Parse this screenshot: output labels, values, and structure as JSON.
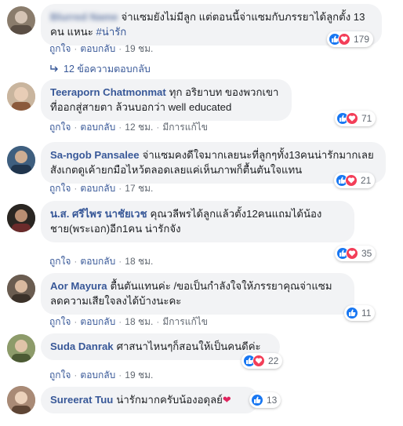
{
  "actions": {
    "like": "ถูกใจ",
    "reply": "ตอบกลับ",
    "edited": "มีการแก้ไข",
    "sep": "·"
  },
  "comments": [
    {
      "author": "Blurred Name",
      "text": "จ่าแซมยังไม่มีลูก แต่ตอนนี้จ่าแซมกับภรรยาได้ลูกตั้ง 13 คน แหนะ ",
      "hashtag": "#น่ารัก",
      "time": "19 ชม.",
      "reactions": "179"
    },
    {
      "author": "Teeraporn Chatmonmat",
      "text": "ทุก อริยาบท ของพวกเขา ที่ออกสู่สายตา ล้วนบอกว่า well educated",
      "time": "12 ชม.",
      "reactions": "71"
    },
    {
      "author": "Sa-ngob Pansalee",
      "text": "จ่าแซมคงดีใจมากเลยนะที่ลูกๆทั้ง13คนน่ารักมากเลย สังเกตดูเค้ายกมือไหว้ตลอดเลยแค่เห็นภาพก็ตื้นตันใจแทน",
      "time": "17 ชม.",
      "reactions": "21"
    },
    {
      "author": "น.ส. ศรีไพร นาชัยเวช",
      "text": "คุณวลีพรได้ลูกแล้วตั้ง12คนแถมได้น้องชาย(พระเอก)อีก1คน น่ารักจัง",
      "time": "18 ชม.",
      "reactions": "35"
    },
    {
      "author": "Aor Mayura",
      "text": "ตื้นตันแทนค่ะ /ขอเป็นกำลังใจให้ภรรยาคุณจ่าแซม ลดความเสียใจลงได้บ้างนะคะ",
      "time": "18 ชม.",
      "reactions": "11"
    },
    {
      "author": "Suda Danrak",
      "text": "ศาสนาไหนๆก็สอนให้เป็นคนดีค่ะ",
      "time": "19 ชม.",
      "reactions": "22"
    },
    {
      "author": "Sureerat Tuu",
      "text": "น่ารักมากครับน้องอดุลย์",
      "heart": "❤",
      "reactions": "13"
    }
  ],
  "replies_link": "12 ข้อความตอบกลับ",
  "colors": {
    "link": "#385898",
    "like": "#1877f2",
    "love": "#f33e58",
    "bubble": "#f2f3f5"
  },
  "icons": {
    "like": "thumbs-up-icon",
    "love": "heart-icon",
    "reply_arrow": "reply-arrow-icon"
  }
}
